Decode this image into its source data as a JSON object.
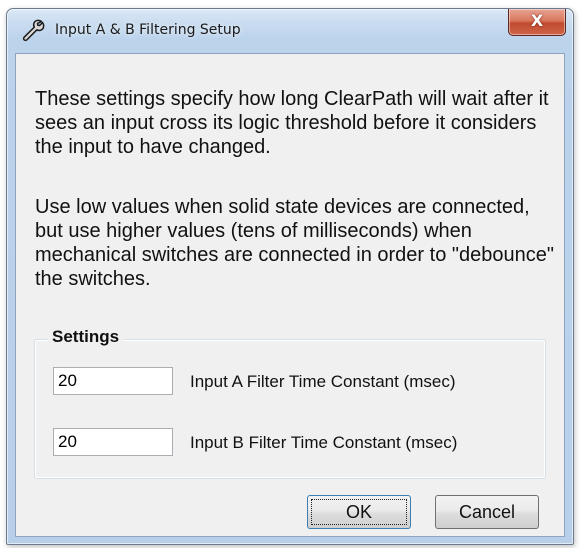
{
  "window": {
    "title": "Input A & B Filtering Setup",
    "icon": "wrench-icon",
    "close_glyph": "X"
  },
  "description": {
    "paragraph1": "These settings specify how long ClearPath will wait after it sees an input cross its logic threshold before it considers the input to have changed.",
    "paragraph2": "Use low values when solid state devices are connected, but use higher values (tens of milliseconds) when mechanical switches are connected in order to \"debounce\" the switches."
  },
  "settings": {
    "group_label": "Settings",
    "input_a": {
      "value": "20",
      "label": "Input A Filter Time Constant (msec)"
    },
    "input_b": {
      "value": "20",
      "label": "Input B Filter Time Constant (msec)"
    }
  },
  "buttons": {
    "ok": "OK",
    "cancel": "Cancel"
  }
}
